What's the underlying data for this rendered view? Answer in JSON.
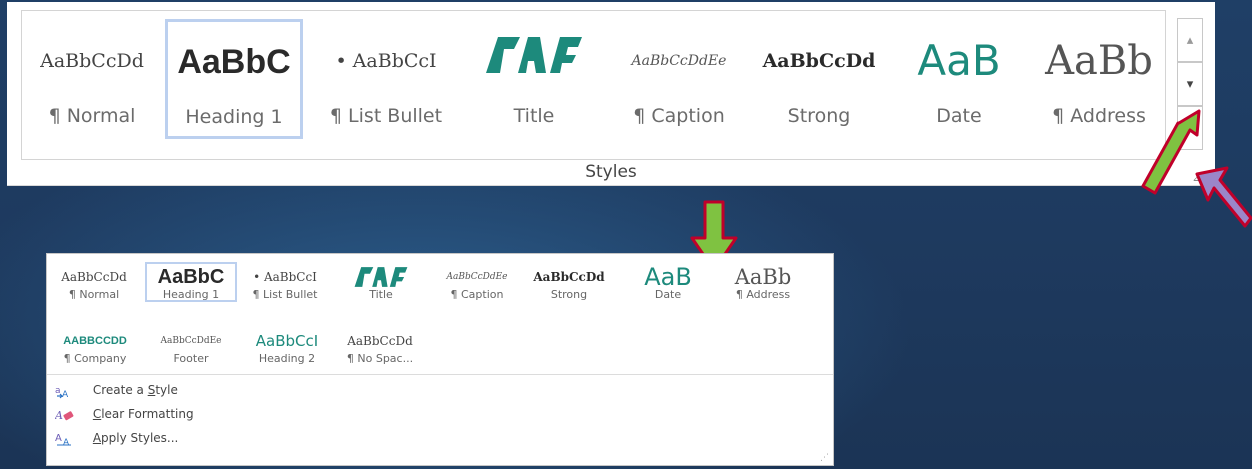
{
  "ribbon": {
    "group_label": "Styles",
    "styles": [
      {
        "name": "¶ Normal",
        "preview": "AaBbCcDd"
      },
      {
        "name": "Heading 1",
        "preview": "AaBbC"
      },
      {
        "name": "¶ List Bullet",
        "preview": "• AaBbCcI"
      },
      {
        "name": "Title",
        "preview": ""
      },
      {
        "name": "¶ Caption",
        "preview": "AaBbCcDdEe"
      },
      {
        "name": "Strong",
        "preview": "AaBbCcDd"
      },
      {
        "name": "Date",
        "preview": "AaB"
      },
      {
        "name": "¶ Address",
        "preview": "AaBb"
      }
    ],
    "scroll_up": "▴",
    "scroll_down": "▾",
    "more": "▾",
    "launcher": "⊿"
  },
  "panel": {
    "styles": [
      {
        "name": "¶ Normal",
        "preview": "AaBbCcDd"
      },
      {
        "name": "Heading 1",
        "preview": "AaBbC"
      },
      {
        "name": "¶ List Bullet",
        "preview": "• AaBbCcI"
      },
      {
        "name": "Title",
        "preview": ""
      },
      {
        "name": "¶ Caption",
        "preview": "AaBbCcDdEe"
      },
      {
        "name": "Strong",
        "preview": "AaBbCcDd"
      },
      {
        "name": "Date",
        "preview": "AaB"
      },
      {
        "name": "¶ Address",
        "preview": "AaBb"
      },
      {
        "name": "¶ Company",
        "preview": "AABBCCDD"
      },
      {
        "name": "Footer",
        "preview": "AaBbCcDdEe"
      },
      {
        "name": "Heading 2",
        "preview": "AaBbCcI"
      },
      {
        "name": "¶ No Spac...",
        "preview": "AaBbCcDd"
      }
    ],
    "commands": {
      "create_style_pre": "Create a ",
      "create_style_u": "S",
      "create_style_post": "tyle",
      "clear_u": "C",
      "clear_post": "lear Formatting",
      "apply_u": "A",
      "apply_post": "pply Styles..."
    }
  },
  "colors": {
    "accent_teal": "#1d8a7c",
    "arrow_green": "#7fc241",
    "arrow_border": "#c0002a",
    "arrow_purple": "#9b86c9"
  }
}
